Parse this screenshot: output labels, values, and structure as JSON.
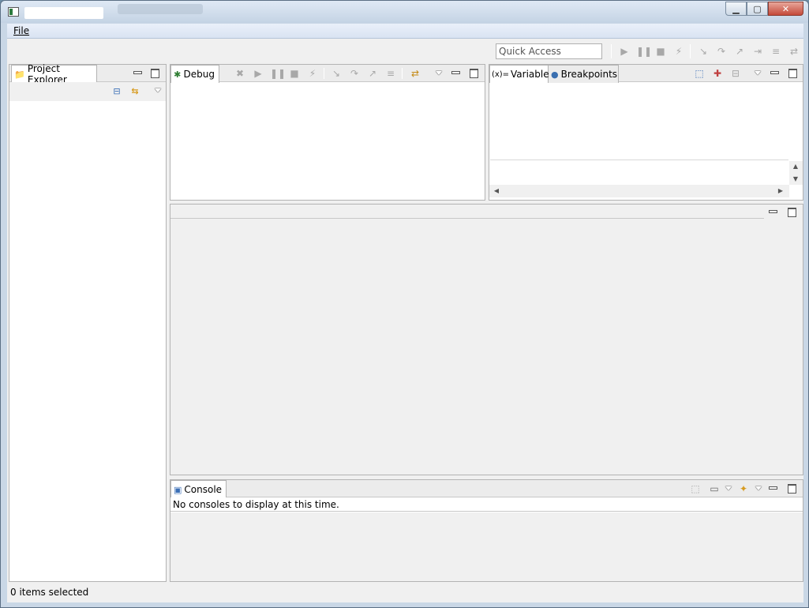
{
  "window": {
    "minimize_glyph": "▁",
    "maximize_glyph": "▢",
    "close_glyph": "✕"
  },
  "menubar": {
    "items": [
      {
        "label": "File"
      }
    ]
  },
  "toolbar": {
    "quick_access_placeholder": "Quick Access"
  },
  "project_explorer": {
    "tab_label": "Project Explorer"
  },
  "debug": {
    "tab_label": "Debug"
  },
  "variables_view": {
    "tabs": [
      {
        "label": "Variables",
        "icon": "(x)="
      },
      {
        "label": "Breakpoints"
      }
    ]
  },
  "console": {
    "tab_label": "Console",
    "message": "No consoles to display at this time."
  },
  "status_bar": {
    "text": "0 items selected"
  },
  "colors": {
    "window_frame": "#c9d7e6",
    "panel_bg": "#ffffff",
    "chrome_bg": "#f0f0f0",
    "close_button": "#c5493a"
  }
}
